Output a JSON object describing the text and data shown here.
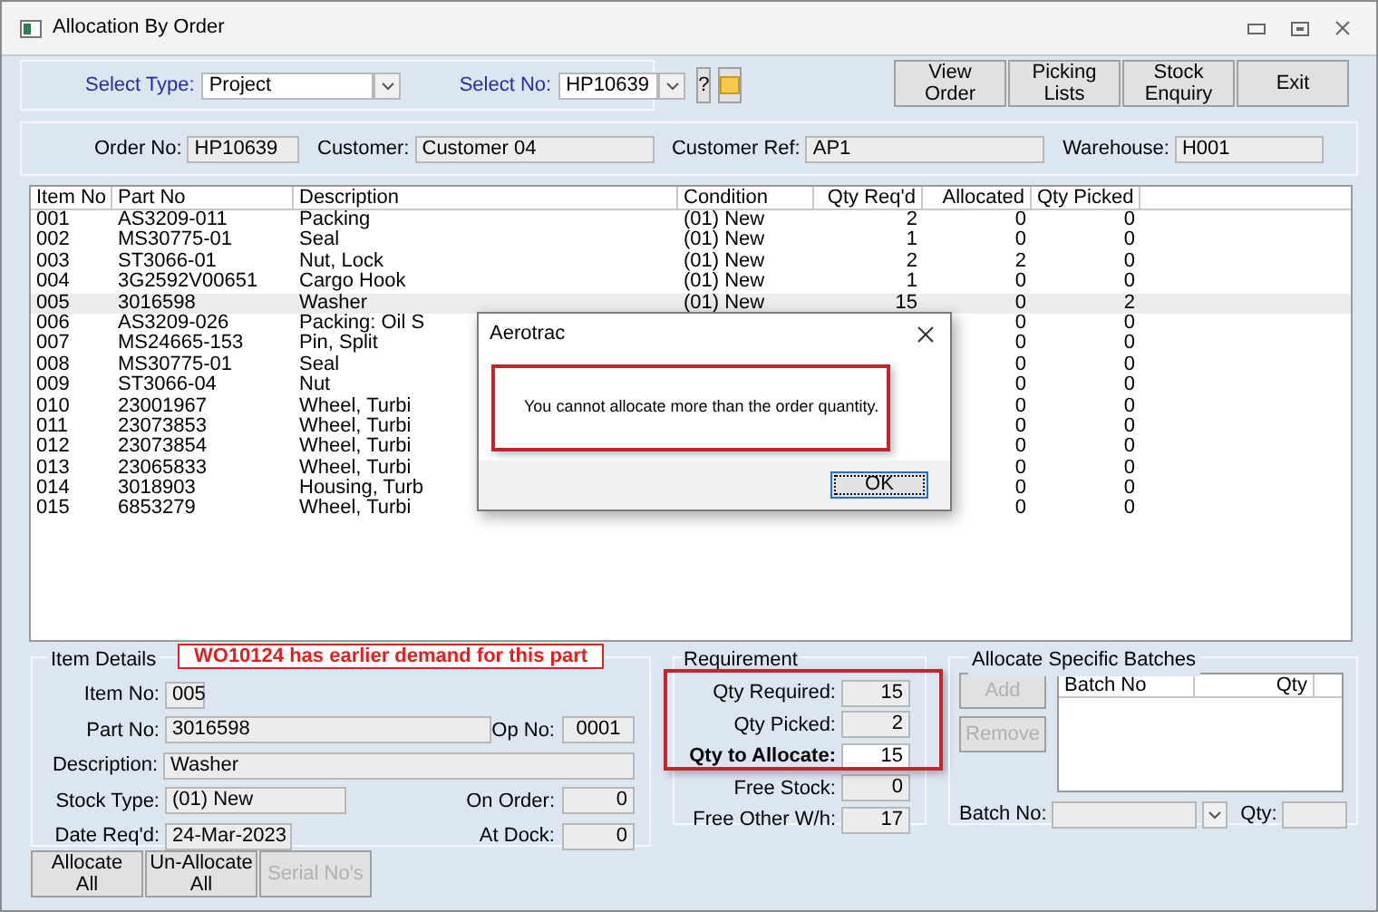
{
  "window": {
    "title": "Allocation By Order"
  },
  "selectors": {
    "type_label": "Select Type:",
    "type_value": "Project",
    "no_label": "Select No:",
    "no_value": "HP10639",
    "help_button": "?"
  },
  "toolbar_buttons": [
    {
      "lines": [
        "View",
        "Order"
      ]
    },
    {
      "lines": [
        "Picking",
        "Lists"
      ]
    },
    {
      "lines": [
        "Stock",
        "Enquiry"
      ]
    },
    {
      "lines": [
        "Exit"
      ]
    }
  ],
  "order_info": [
    {
      "label": "Order No:",
      "value": "HP10639"
    },
    {
      "label": "Customer:",
      "value": "Customer 04"
    },
    {
      "label": "Customer Ref:",
      "value": "AP1"
    },
    {
      "label": "Warehouse:",
      "value": "H001"
    }
  ],
  "table": {
    "columns": [
      "Item No",
      "Part No",
      "Description",
      "Condition",
      "Qty Req'd",
      "Allocated",
      "Qty Picked"
    ],
    "rows": [
      {
        "item": "001",
        "part": "AS3209-011",
        "description": "Packing",
        "condition": "(01) New",
        "qty_reqd": "2",
        "allocated": "0",
        "qty_picked": "0",
        "selected": false
      },
      {
        "item": "002",
        "part": "MS30775-01",
        "description": "Seal",
        "condition": "(01) New",
        "qty_reqd": "1",
        "allocated": "0",
        "qty_picked": "0",
        "selected": false
      },
      {
        "item": "003",
        "part": "ST3066-01",
        "description": "Nut, Lock",
        "condition": "(01) New",
        "qty_reqd": "2",
        "allocated": "2",
        "qty_picked": "0",
        "selected": false
      },
      {
        "item": "004",
        "part": "3G2592V00651",
        "description": "Cargo Hook",
        "condition": "(01) New",
        "qty_reqd": "1",
        "allocated": "0",
        "qty_picked": "0",
        "selected": false
      },
      {
        "item": "005",
        "part": "3016598",
        "description": "Washer",
        "condition": "(01) New",
        "qty_reqd": "15",
        "allocated": "0",
        "qty_picked": "2",
        "selected": true
      },
      {
        "item": "006",
        "part": "AS3209-026",
        "description": "Packing: Oil S",
        "allocated": "0",
        "qty_picked": "0",
        "selected": false
      },
      {
        "item": "007",
        "part": "MS24665-153",
        "description": "Pin, Split",
        "allocated": "0",
        "qty_picked": "0",
        "selected": false
      },
      {
        "item": "008",
        "part": "MS30775-01",
        "description": "Seal",
        "allocated": "0",
        "qty_picked": "0",
        "selected": false
      },
      {
        "item": "009",
        "part": "ST3066-04",
        "description": "Nut",
        "allocated": "0",
        "qty_picked": "0",
        "selected": false
      },
      {
        "item": "010",
        "part": "23001967",
        "description": "Wheel, Turbi",
        "allocated": "0",
        "qty_picked": "0",
        "selected": false
      },
      {
        "item": "011",
        "part": "23073853",
        "description": "Wheel, Turbi",
        "allocated": "0",
        "qty_picked": "0",
        "selected": false
      },
      {
        "item": "012",
        "part": "23073854",
        "description": "Wheel, Turbi",
        "allocated": "0",
        "qty_picked": "0",
        "selected": false
      },
      {
        "item": "013",
        "part": "23065833",
        "description": "Wheel, Turbi",
        "allocated": "0",
        "qty_picked": "0",
        "selected": false
      },
      {
        "item": "014",
        "part": "3018903",
        "description": "Housing, Turb",
        "allocated": "0",
        "qty_picked": "0",
        "selected": false
      },
      {
        "item": "015",
        "part": "6853279",
        "description": "Wheel, Turbi",
        "allocated": "0",
        "qty_picked": "0",
        "selected": false
      }
    ]
  },
  "alert": {
    "title": "Aerotrac",
    "message": "You cannot allocate more than the order quantity.",
    "ok": "OK"
  },
  "item_details": {
    "title": "Item Details",
    "warning": "WO10124 has earlier demand for this part",
    "fields": [
      {
        "label": "Item No:",
        "value": "005"
      },
      {
        "label": "Part No:",
        "value": "3016598"
      },
      {
        "label": "Op No:",
        "value": "0001"
      },
      {
        "label": "Description:",
        "value": "Washer"
      },
      {
        "label": "Stock Type:",
        "value": "(01) New"
      },
      {
        "label": "On Order:",
        "value": "0"
      },
      {
        "label": "Date Req'd:",
        "value": "24-Mar-2023"
      },
      {
        "label": "At Dock:",
        "value": "0"
      }
    ]
  },
  "requirement": {
    "title": "Requirement",
    "fields": [
      {
        "label": "Qty Required:",
        "value": "15",
        "editable": false
      },
      {
        "label": "Qty Picked:",
        "value": "2",
        "editable": false
      },
      {
        "label": "Qty to Allocate:",
        "value": "15",
        "editable": true
      },
      {
        "label": "Free Stock:",
        "value": "0",
        "editable": false
      },
      {
        "label": "Free Other W/h:",
        "value": "17",
        "editable": false
      }
    ]
  },
  "batches": {
    "title": "Allocate Specific Batches",
    "buttons": [
      {
        "label": "Add",
        "disabled": true
      },
      {
        "label": "Remove",
        "disabled": true
      }
    ],
    "columns": [
      "Batch No",
      "Qty"
    ],
    "batch_label": "Batch No:",
    "qty_label": "Qty:"
  },
  "bottom_buttons": [
    {
      "lines": [
        "Allocate",
        "All"
      ],
      "disabled": false
    },
    {
      "lines": [
        "Un-Allocate",
        "All"
      ],
      "disabled": false
    },
    {
      "lines": [
        "Serial No's"
      ],
      "disabled": true
    }
  ]
}
